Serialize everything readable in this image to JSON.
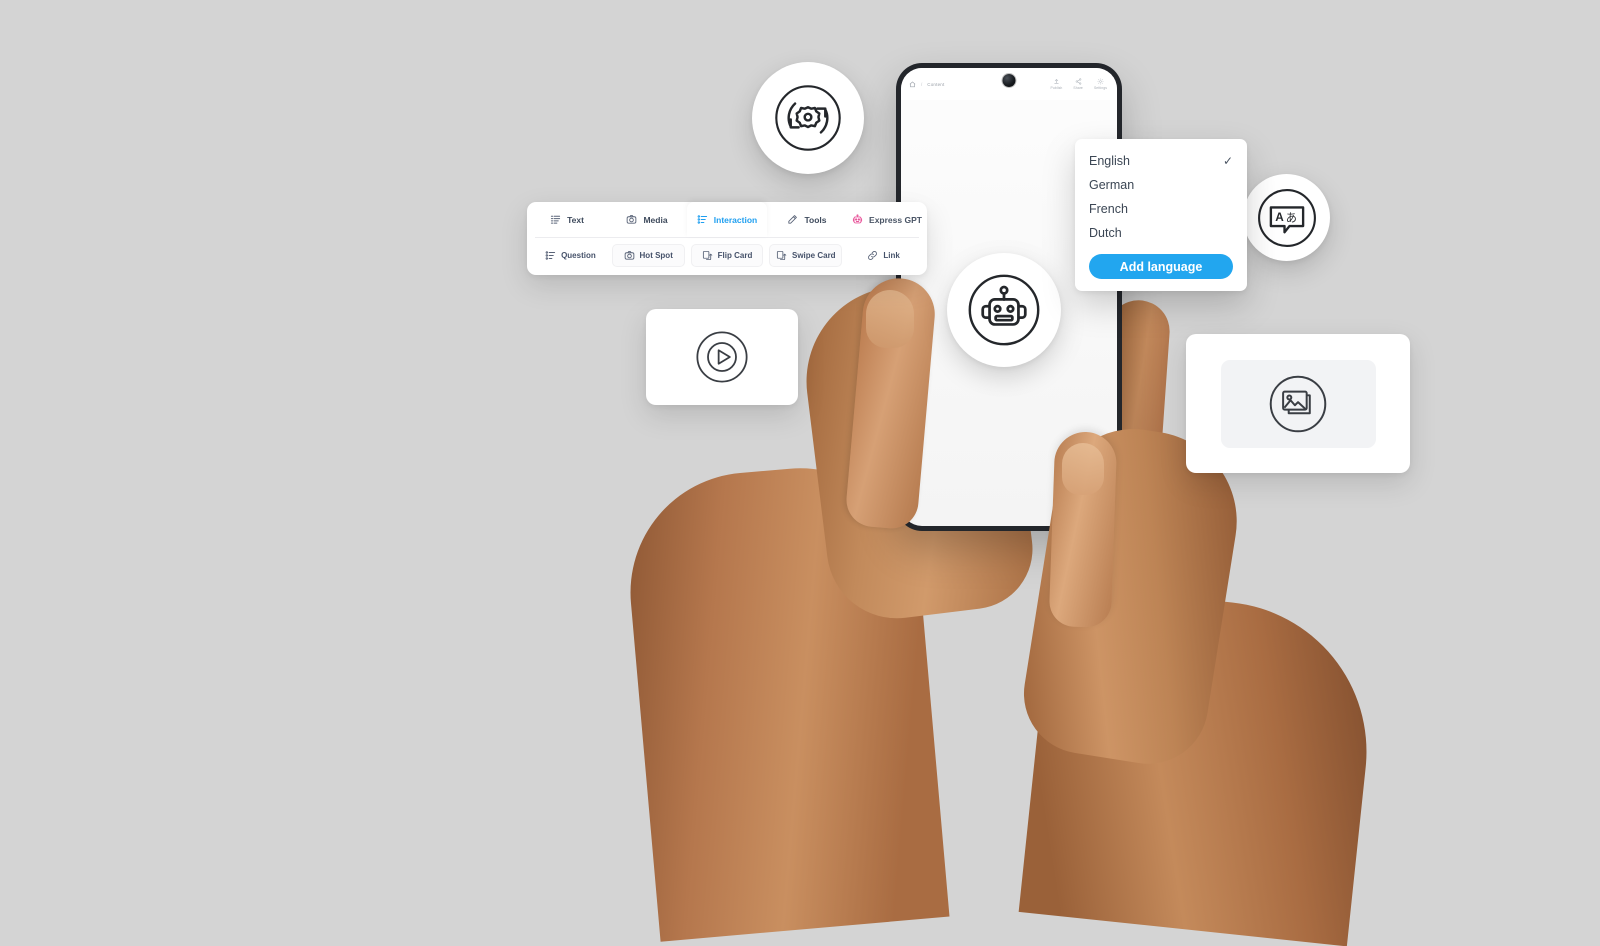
{
  "background_color": "#d4d4d4",
  "accent_color": "#22a6ef",
  "gpt_color": "#e8549a",
  "phone": {
    "topbar": {
      "home_icon": "home-icon",
      "separator": "/",
      "breadcrumb": "Content",
      "camera": "front-camera",
      "actions": [
        {
          "icon": "publish-icon",
          "label": "Publish"
        },
        {
          "icon": "share-icon",
          "label": "Share"
        },
        {
          "icon": "settings-icon",
          "label": "Settings"
        }
      ]
    },
    "screen_badge_icon": "robot-icon"
  },
  "toolbar": {
    "tabs": [
      {
        "label": "Text",
        "icon": "text-lines-icon",
        "active": false
      },
      {
        "label": "Media",
        "icon": "camera-circle-icon",
        "active": false
      },
      {
        "label": "Interaction",
        "icon": "interaction-list-icon",
        "active": true
      },
      {
        "label": "Tools",
        "icon": "pencil-icon",
        "active": false
      },
      {
        "label": "Express GPT",
        "icon": "robot-pink-icon",
        "active": false
      }
    ],
    "items": [
      {
        "label": "Question",
        "icon": "question-list-icon"
      },
      {
        "label": "Hot Spot",
        "icon": "hotspot-circle-icon"
      },
      {
        "label": "Flip Card",
        "icon": "flip-card-icon"
      },
      {
        "label": "Swipe Card",
        "icon": "swipe-card-icon"
      },
      {
        "label": "Link",
        "icon": "link-icon"
      }
    ]
  },
  "language_menu": {
    "items": [
      {
        "label": "English",
        "selected": true,
        "check": "✓"
      },
      {
        "label": "German",
        "selected": false,
        "check": ""
      },
      {
        "label": "French",
        "selected": false,
        "check": ""
      },
      {
        "label": "Dutch",
        "selected": false,
        "check": ""
      }
    ],
    "add_button_label": "Add language"
  },
  "floating_badges": [
    {
      "name": "sync-settings-badge",
      "icon": "gear-refresh-icon"
    },
    {
      "name": "ai-robot-badge",
      "icon": "robot-icon"
    },
    {
      "name": "translate-badge",
      "icon": "translate-icon",
      "glyphs": "Aあ"
    }
  ],
  "media_cards": [
    {
      "name": "video-card",
      "icon": "play-circle-icon"
    },
    {
      "name": "image-card",
      "icon": "image-stack-icon"
    }
  ]
}
